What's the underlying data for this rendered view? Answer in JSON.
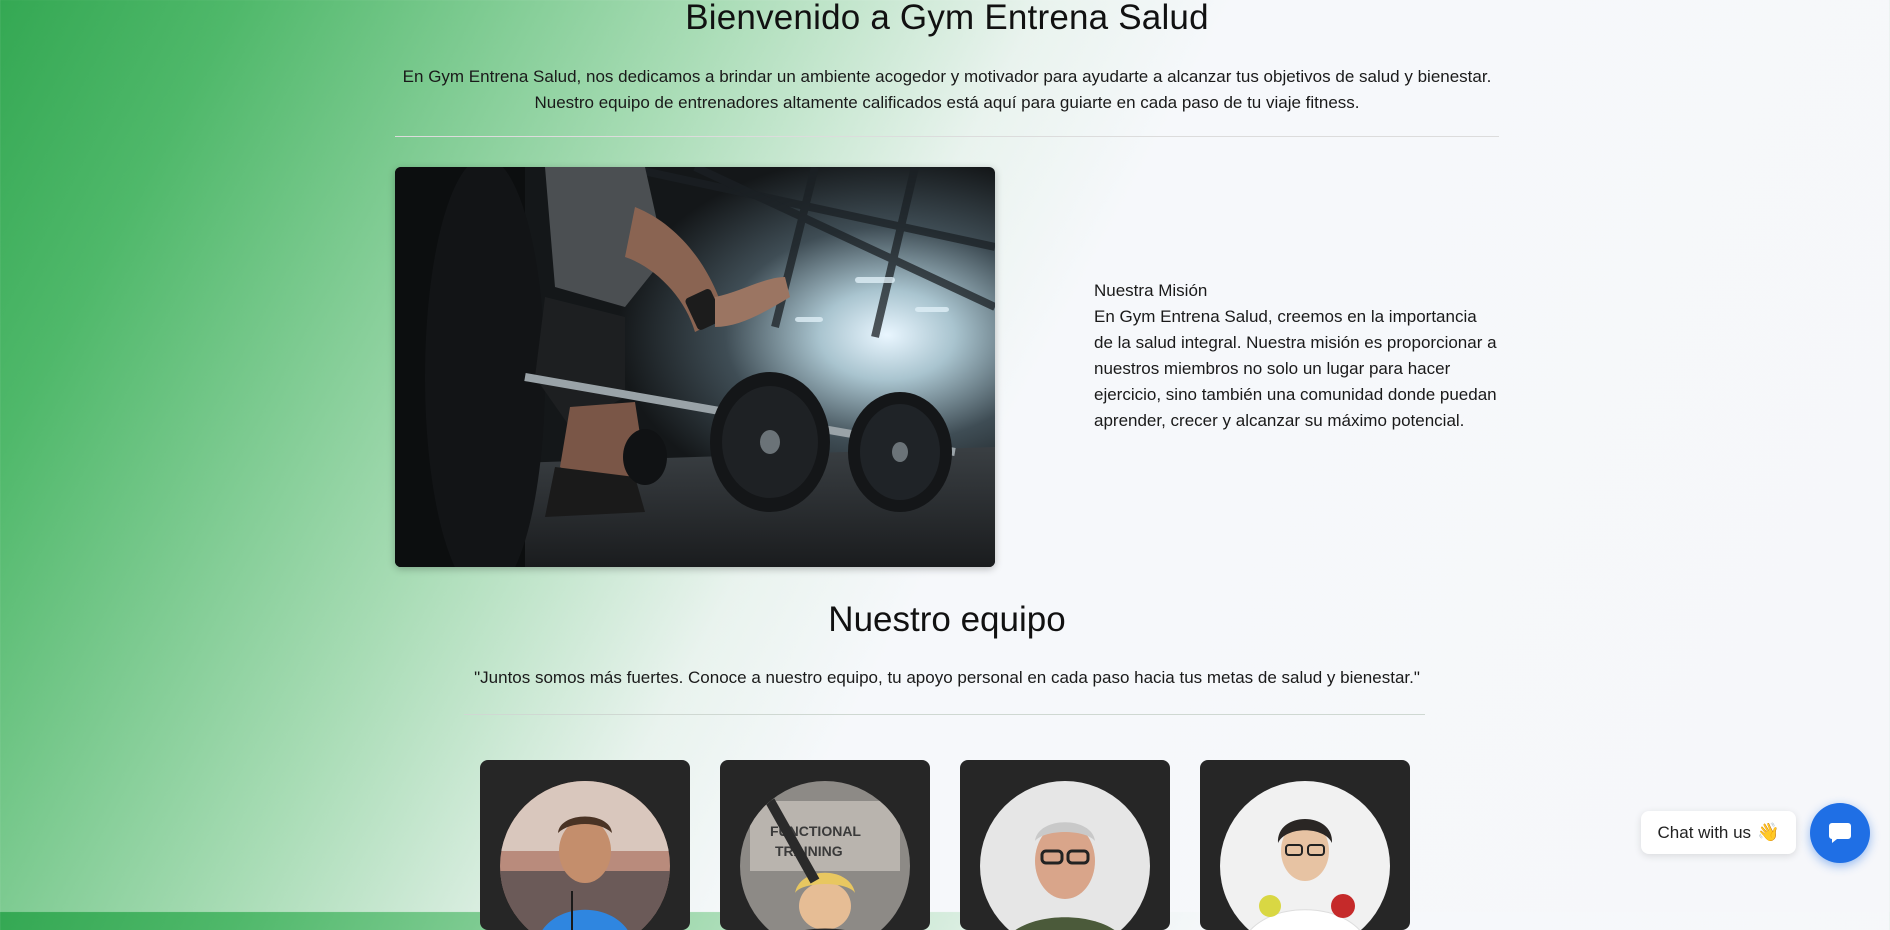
{
  "header": {
    "title": "Bienvenido a Gym Entrena Salud",
    "intro_line1": "En Gym Entrena Salud, nos dedicamos a brindar un ambiente acogedor y motivador para ayudarte a alcanzar tus objetivos de salud y bienestar.",
    "intro_line2": "Nuestro equipo de entrenadores altamente calificados está aquí para guiarte en cada paso de tu viaje fitness."
  },
  "mission": {
    "heading": "Nuestra Misión",
    "text": "En Gym Entrena Salud, creemos en la importancia de la salud integral. Nuestra misión es proporcionar a nuestros miembros no solo un lugar para hacer ejercicio, sino también una comunidad donde puedan aprender, crecer y alcanzar su máximo potencial."
  },
  "team": {
    "title": "Nuestro equipo",
    "quote": "\"Juntos somos más fuertes. Conoce a nuestro equipo, tu apoyo personal en cada paso hacia tus metas de salud y bienestar.\""
  },
  "chat": {
    "label": "Chat with us",
    "emoji": "👋"
  },
  "icons": {
    "chat_button": "chat-bubble-icon"
  },
  "colors": {
    "chat_accent": "#1f6fe5",
    "card_background": "#262626",
    "gradient_green": "#34a853"
  }
}
